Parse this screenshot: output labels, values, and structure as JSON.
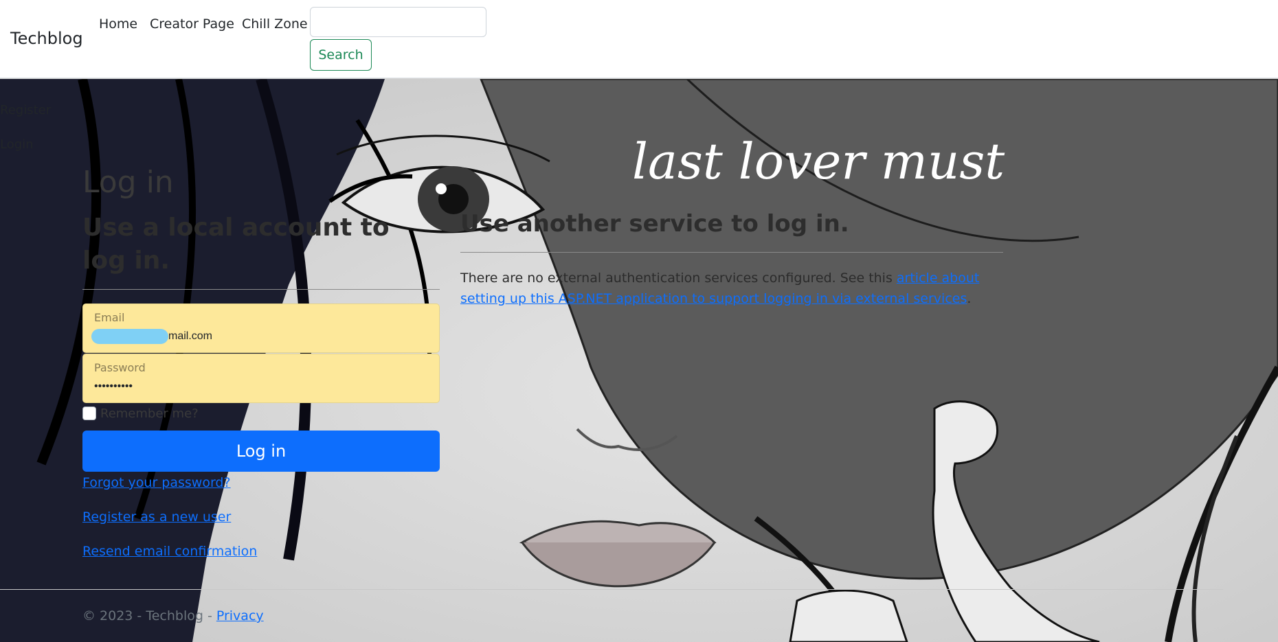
{
  "navbar": {
    "brand": "Techblog",
    "links": [
      "Home",
      "Creator Page",
      "Chill Zone"
    ],
    "search_placeholder": "",
    "search_button": "Search"
  },
  "sidebar": {
    "register": "Register",
    "login": "Login"
  },
  "page": {
    "title": "Log in",
    "local_heading": "Use a local account to log in.",
    "external_heading": "Use another service to log in.",
    "external_text": "There are no external authentication services configured. See this ",
    "external_link": "article about setting up this ASP.NET application to support logging in via external services",
    "external_suffix": "."
  },
  "form": {
    "email_label": "Email",
    "email_value": "mail.com",
    "password_label": "Password",
    "password_value": "••••••••••",
    "remember_label": "Remember me?",
    "submit": "Log in",
    "links": [
      "Forgot your password?",
      "Register as a new user",
      "Resend email confirmation"
    ]
  },
  "background": {
    "script_text": "last lover must"
  },
  "footer": {
    "text": "© 2023 - Techblog - ",
    "privacy": "Privacy"
  },
  "colors": {
    "primary": "#0d6efd",
    "success": "#198754",
    "autofill": "#fde89a"
  }
}
